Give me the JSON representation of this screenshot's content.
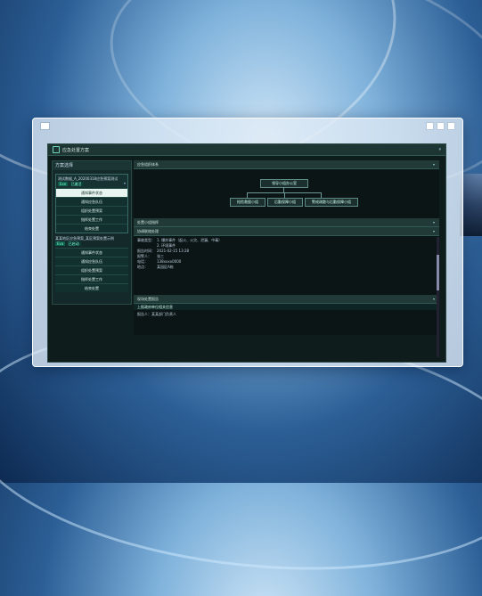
{
  "app": {
    "title": "应急处置方案"
  },
  "left": {
    "title": "方案选择",
    "group1": {
      "name": "测试数据_A_20200318应急预案测试",
      "tags": [
        "Exe",
        "已激活"
      ],
      "items": [
        "通知事件状态",
        "通知应急队伍",
        "组织处置预案",
        "指挥处置工作",
        "结束处置"
      ],
      "active_index": 0
    },
    "group2": {
      "name": "某某地区应急预案_某区预案处置示例",
      "tags": [
        "Eva",
        "已启动"
      ],
      "items": [
        "通知事件状态",
        "通知应急队伍",
        "组织处置预案",
        "指挥处置工作",
        "结束处置"
      ]
    }
  },
  "right": {
    "org_title": "应急组织体系",
    "org_nodes": {
      "root": "领导小组办公室",
      "c1": "抢险救援小组",
      "c2": "后勤保障小组",
      "c3": "警戒疏散与后勤保障小组"
    },
    "section2": "处置小组指挥",
    "section3": "协调联络处理",
    "rows": [
      {
        "k": "事故类型：",
        "v": "1. 爆炸事件（起火、火灾、泄漏、中毒）"
      },
      {
        "k": "",
        "v": "2. 环境事件"
      },
      {
        "k": "报告时间：",
        "v": "2021-02-15 13:28"
      },
      {
        "k": "报警人：",
        "v": "张三"
      },
      {
        "k": "电话：",
        "v": "138xxxx0000"
      },
      {
        "k": "地点：",
        "v": "某园区A栋"
      }
    ],
    "section4": "现场处置报告",
    "section5": "上报政府单位相关信息",
    "footer_line": "报告人：某某部门负责人"
  }
}
